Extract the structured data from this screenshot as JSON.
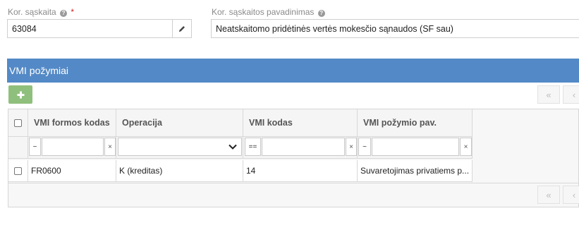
{
  "form": {
    "account_label": "Kor. sąskaita",
    "account_help": "?",
    "account_required": "*",
    "account_value": "63084",
    "name_label": "Kor. sąskaitos pavadinimas",
    "name_help": "?",
    "name_value": "Neatskaitomo pridėtinės vertės mokesčio sąnaudos (SF sau)"
  },
  "section": {
    "title": "VMI požymiai",
    "add_label": "+"
  },
  "pager": {
    "first_label": "«",
    "prev_label": "‹"
  },
  "grid": {
    "columns": [
      "VMI formos kodas",
      "Operacija",
      "VMI kodas",
      "VMI požymio pav."
    ],
    "filters": {
      "form_code_op": "~",
      "vmi_code_op": "==",
      "name_op": "~",
      "clear": "×"
    },
    "rows": [
      {
        "form_code": "FR0600",
        "operation": "K (kreditas)",
        "vmi_code": "14",
        "name": "Suvaretojimas privatiems p..."
      }
    ]
  },
  "icons": {
    "edit": "pencil-icon",
    "dropdown": "chevron-down-icon",
    "add": "plus-icon"
  }
}
